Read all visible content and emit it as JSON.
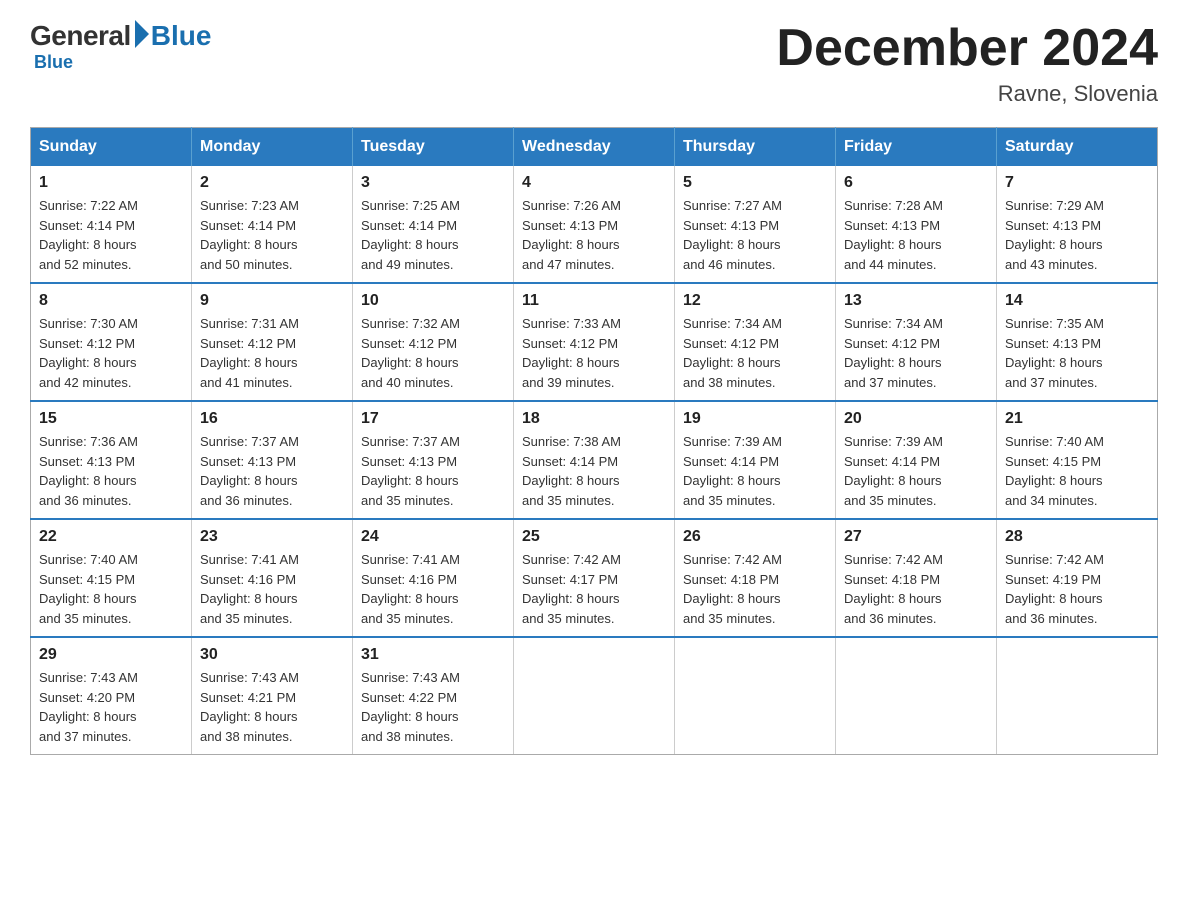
{
  "logo": {
    "general": "General",
    "blue": "Blue"
  },
  "title": "December 2024",
  "location": "Ravne, Slovenia",
  "weekdays": [
    "Sunday",
    "Monday",
    "Tuesday",
    "Wednesday",
    "Thursday",
    "Friday",
    "Saturday"
  ],
  "weeks": [
    [
      {
        "day": "1",
        "sunrise": "7:22 AM",
        "sunset": "4:14 PM",
        "daylight": "8 hours and 52 minutes."
      },
      {
        "day": "2",
        "sunrise": "7:23 AM",
        "sunset": "4:14 PM",
        "daylight": "8 hours and 50 minutes."
      },
      {
        "day": "3",
        "sunrise": "7:25 AM",
        "sunset": "4:14 PM",
        "daylight": "8 hours and 49 minutes."
      },
      {
        "day": "4",
        "sunrise": "7:26 AM",
        "sunset": "4:13 PM",
        "daylight": "8 hours and 47 minutes."
      },
      {
        "day": "5",
        "sunrise": "7:27 AM",
        "sunset": "4:13 PM",
        "daylight": "8 hours and 46 minutes."
      },
      {
        "day": "6",
        "sunrise": "7:28 AM",
        "sunset": "4:13 PM",
        "daylight": "8 hours and 44 minutes."
      },
      {
        "day": "7",
        "sunrise": "7:29 AM",
        "sunset": "4:13 PM",
        "daylight": "8 hours and 43 minutes."
      }
    ],
    [
      {
        "day": "8",
        "sunrise": "7:30 AM",
        "sunset": "4:12 PM",
        "daylight": "8 hours and 42 minutes."
      },
      {
        "day": "9",
        "sunrise": "7:31 AM",
        "sunset": "4:12 PM",
        "daylight": "8 hours and 41 minutes."
      },
      {
        "day": "10",
        "sunrise": "7:32 AM",
        "sunset": "4:12 PM",
        "daylight": "8 hours and 40 minutes."
      },
      {
        "day": "11",
        "sunrise": "7:33 AM",
        "sunset": "4:12 PM",
        "daylight": "8 hours and 39 minutes."
      },
      {
        "day": "12",
        "sunrise": "7:34 AM",
        "sunset": "4:12 PM",
        "daylight": "8 hours and 38 minutes."
      },
      {
        "day": "13",
        "sunrise": "7:34 AM",
        "sunset": "4:12 PM",
        "daylight": "8 hours and 37 minutes."
      },
      {
        "day": "14",
        "sunrise": "7:35 AM",
        "sunset": "4:13 PM",
        "daylight": "8 hours and 37 minutes."
      }
    ],
    [
      {
        "day": "15",
        "sunrise": "7:36 AM",
        "sunset": "4:13 PM",
        "daylight": "8 hours and 36 minutes."
      },
      {
        "day": "16",
        "sunrise": "7:37 AM",
        "sunset": "4:13 PM",
        "daylight": "8 hours and 36 minutes."
      },
      {
        "day": "17",
        "sunrise": "7:37 AM",
        "sunset": "4:13 PM",
        "daylight": "8 hours and 35 minutes."
      },
      {
        "day": "18",
        "sunrise": "7:38 AM",
        "sunset": "4:14 PM",
        "daylight": "8 hours and 35 minutes."
      },
      {
        "day": "19",
        "sunrise": "7:39 AM",
        "sunset": "4:14 PM",
        "daylight": "8 hours and 35 minutes."
      },
      {
        "day": "20",
        "sunrise": "7:39 AM",
        "sunset": "4:14 PM",
        "daylight": "8 hours and 35 minutes."
      },
      {
        "day": "21",
        "sunrise": "7:40 AM",
        "sunset": "4:15 PM",
        "daylight": "8 hours and 34 minutes."
      }
    ],
    [
      {
        "day": "22",
        "sunrise": "7:40 AM",
        "sunset": "4:15 PM",
        "daylight": "8 hours and 35 minutes."
      },
      {
        "day": "23",
        "sunrise": "7:41 AM",
        "sunset": "4:16 PM",
        "daylight": "8 hours and 35 minutes."
      },
      {
        "day": "24",
        "sunrise": "7:41 AM",
        "sunset": "4:16 PM",
        "daylight": "8 hours and 35 minutes."
      },
      {
        "day": "25",
        "sunrise": "7:42 AM",
        "sunset": "4:17 PM",
        "daylight": "8 hours and 35 minutes."
      },
      {
        "day": "26",
        "sunrise": "7:42 AM",
        "sunset": "4:18 PM",
        "daylight": "8 hours and 35 minutes."
      },
      {
        "day": "27",
        "sunrise": "7:42 AM",
        "sunset": "4:18 PM",
        "daylight": "8 hours and 36 minutes."
      },
      {
        "day": "28",
        "sunrise": "7:42 AM",
        "sunset": "4:19 PM",
        "daylight": "8 hours and 36 minutes."
      }
    ],
    [
      {
        "day": "29",
        "sunrise": "7:43 AM",
        "sunset": "4:20 PM",
        "daylight": "8 hours and 37 minutes."
      },
      {
        "day": "30",
        "sunrise": "7:43 AM",
        "sunset": "4:21 PM",
        "daylight": "8 hours and 38 minutes."
      },
      {
        "day": "31",
        "sunrise": "7:43 AM",
        "sunset": "4:22 PM",
        "daylight": "8 hours and 38 minutes."
      },
      null,
      null,
      null,
      null
    ]
  ],
  "labels": {
    "sunrise": "Sunrise: ",
    "sunset": "Sunset: ",
    "daylight": "Daylight: "
  }
}
